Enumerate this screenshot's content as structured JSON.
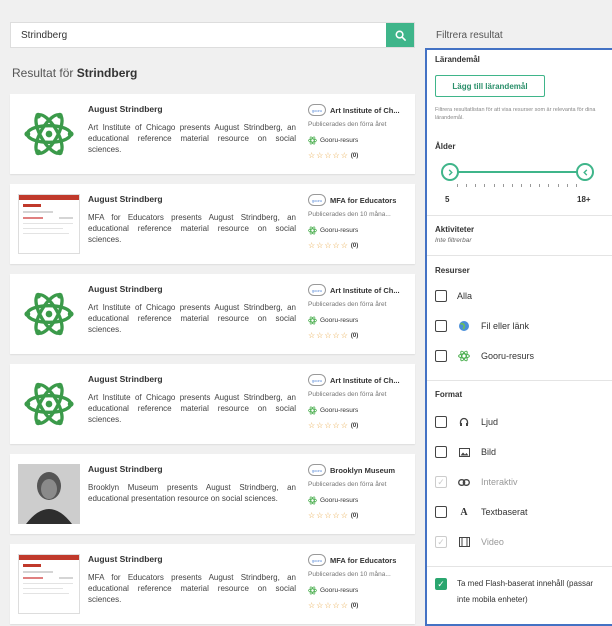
{
  "search": {
    "value": "Strindberg"
  },
  "results": {
    "prefix": "Resultat för",
    "query": "Strindberg"
  },
  "cards": [
    {
      "thumb": "atom",
      "title": "August Strindberg",
      "desc": "Art Institute of Chicago presents August Strindberg, an educational reference material resource on social sciences.",
      "publisher": "Art Institute of Ch...",
      "date": "Publicerades den förra året",
      "type": "Gooru-resurs",
      "rating": "(0)"
    },
    {
      "thumb": "doc",
      "title": "August Strindberg",
      "desc": "MFA for Educators presents August Strindberg, an educational reference material resource on social sciences.",
      "publisher": "MFA for Educators",
      "date": "Publicerades den 10 måna...",
      "type": "Gooru-resurs",
      "rating": "(0)"
    },
    {
      "thumb": "atom",
      "title": "August Strindberg",
      "desc": "Art Institute of Chicago presents August Strindberg, an educational reference material resource on social sciences.",
      "publisher": "Art Institute of Ch...",
      "date": "Publicerades den förra året",
      "type": "Gooru-resurs",
      "rating": "(0)"
    },
    {
      "thumb": "atom",
      "title": "August Strindberg",
      "desc": "Art Institute of Chicago presents August Strindberg, an educational reference material resource on social sciences.",
      "publisher": "Art Institute of Ch...",
      "date": "Publicerades den förra året",
      "type": "Gooru-resurs",
      "rating": "(0)"
    },
    {
      "thumb": "photo",
      "title": "August Strindberg",
      "desc": "Brooklyn Museum presents August Strindberg, an educational presentation resource on social sciences.",
      "publisher": "Brooklyn Museum",
      "date": "Publicerades den förra året",
      "type": "Gooru-resurs",
      "rating": "(0)"
    },
    {
      "thumb": "doc",
      "title": "August Strindberg",
      "desc": "MFA for Educators presents August Strindberg, an educational reference material resource on social sciences.",
      "publisher": "MFA for Educators",
      "date": "Publicerades den 10 måna...",
      "type": "Gooru-resurs",
      "rating": "(0)"
    }
  ],
  "filter": {
    "title": "Filtrera resultat",
    "goals_label": "Lärandemål",
    "add_goal_button": "Lägg till lärandemål",
    "goals_help": "Filtrera resultatlistan för att visa resurser som är relevanta för dina lärandemål.",
    "age_label": "Ålder",
    "age_min": "5",
    "age_max": "18+",
    "activities_label": "Aktiviteter",
    "activities_note": "Inte filtrerbar",
    "resources_label": "Resurser",
    "res_all": "Alla",
    "res_file": "Fil eller länk",
    "res_gooru": "Gooru-resurs",
    "format_label": "Format",
    "fmt_audio": "Ljud",
    "fmt_image": "Bild",
    "fmt_interactive": "Interaktiv",
    "fmt_text": "Textbaserat",
    "fmt_video": "Video",
    "flash_text": "Ta med Flash-baserat innehåll (passar inte mobila enheter)"
  },
  "colors": {
    "accent": "#3fb58a",
    "panel_border": "#4472c4",
    "star": "#e6a23c"
  }
}
